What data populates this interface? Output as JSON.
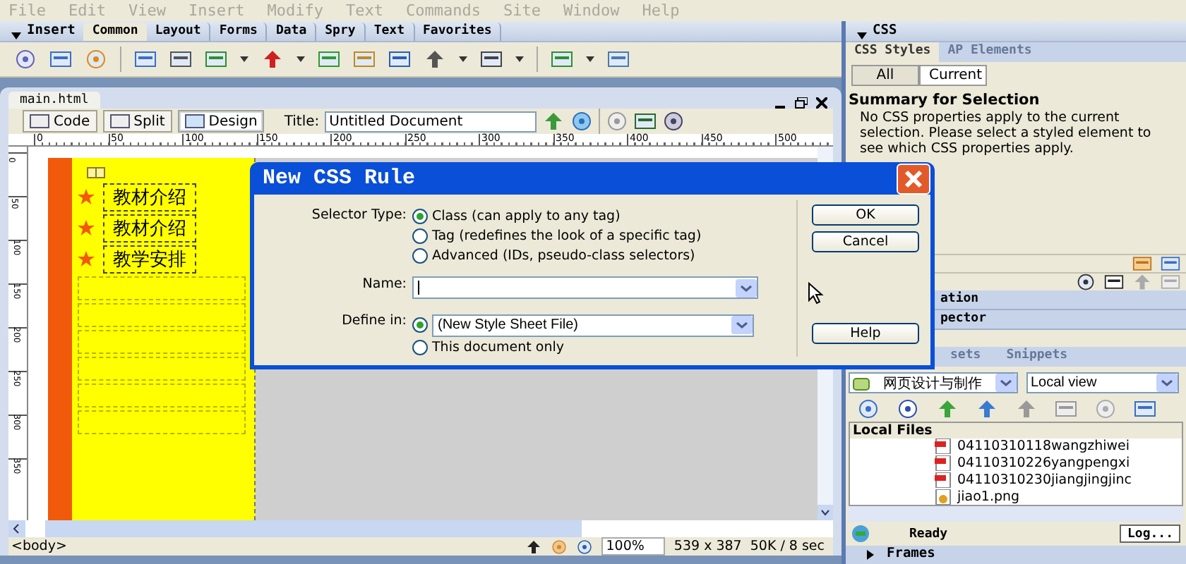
{
  "menu": [
    "File",
    "Edit",
    "View",
    "Insert",
    "Modify",
    "Text",
    "Commands",
    "Site",
    "Window",
    "Help"
  ],
  "insert_bar": {
    "title": "Insert",
    "tabs": [
      {
        "label": "Common",
        "selected": true
      },
      {
        "label": "Layout",
        "selected": false
      },
      {
        "label": "Forms",
        "selected": false
      },
      {
        "label": "Data",
        "selected": false
      },
      {
        "label": "Spry",
        "selected": false
      },
      {
        "label": "Text",
        "selected": false
      },
      {
        "label": "Favorites",
        "selected": false
      }
    ]
  },
  "document": {
    "tab": "main.html",
    "views": [
      {
        "label": "Code",
        "selected": false
      },
      {
        "label": "Split",
        "selected": false
      },
      {
        "label": "Design",
        "selected": true
      }
    ],
    "title_label": "Title:",
    "title_value": "Untitled Document",
    "ruler": [
      "0",
      "50",
      "100",
      "150",
      "200",
      "250",
      "300",
      "350",
      "400",
      "450",
      "500"
    ],
    "vertical_ruler": [
      "0",
      "50",
      "100",
      "150",
      "200",
      "250",
      "300",
      "350"
    ],
    "nav_items": [
      "教材介绍",
      "教材介绍",
      "教学安排"
    ],
    "tag": "<body>",
    "zoom": "100%",
    "dimensions": "539 x 387",
    "download": "50K / 8 sec"
  },
  "dialog": {
    "title": "New CSS Rule",
    "selector_label": "Selector Type:",
    "selector_options": [
      {
        "label": "Class (can apply to any tag)",
        "selected": true
      },
      {
        "label": "Tag (redefines the look of a specific tag)",
        "selected": false
      },
      {
        "label": "Advanced (IDs, pseudo-class selectors)",
        "selected": false
      }
    ],
    "name_label": "Name:",
    "define_label": "Define in:",
    "define_options": [
      {
        "kind": "select",
        "label": "(New Style Sheet File)",
        "selected": true
      },
      {
        "kind": "plain",
        "label": "This document only",
        "selected": false
      }
    ],
    "buttons": [
      "OK",
      "Cancel",
      "Help"
    ]
  },
  "css_panel": {
    "title": "CSS",
    "tabs": [
      {
        "label": "CSS Styles",
        "selected": true
      },
      {
        "label": "AP Elements",
        "selected": false
      }
    ],
    "modes": [
      {
        "label": "All",
        "selected": false
      },
      {
        "label": "Current",
        "selected": true
      }
    ],
    "summary_title": "Summary for Selection",
    "summary_text": "No CSS properties apply to the current selection.  Please select a styled element to see which CSS properties apply."
  },
  "collapsed_panels": [
    "ation",
    "pector"
  ],
  "files_panel": {
    "tabs": [
      "sets",
      "Snippets"
    ],
    "site": "网页设计与制作",
    "view": "Local view",
    "header": "Local Files",
    "files": [
      {
        "name": "04110310118wangzhiwei",
        "kind": "pdf"
      },
      {
        "name": "04110310226yangpengxi",
        "kind": "pdf"
      },
      {
        "name": "04110310230jiangjingjinc",
        "kind": "pdf"
      },
      {
        "name": "jiao1.png",
        "kind": "image"
      }
    ],
    "status": "Ready",
    "log_button": "Log...",
    "frames": "Frames"
  }
}
